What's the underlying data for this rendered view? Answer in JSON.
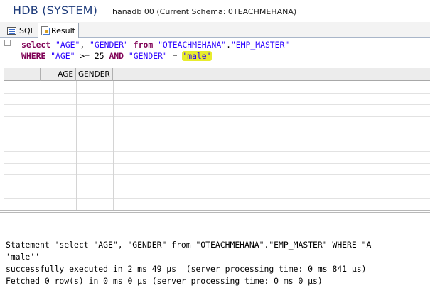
{
  "window": {
    "title": "HDB (SYSTEM)",
    "subtitle": "hanadb 00 (Current Schema: 0TEACHMEHANA)"
  },
  "tabs": [
    {
      "label": "SQL",
      "icon": "sql-editor-icon",
      "active": false
    },
    {
      "label": "Result",
      "icon": "result-icon",
      "active": true
    }
  ],
  "editor": {
    "line1": {
      "kw_select": "select",
      "col1": "\"AGE\"",
      "comma": ", ",
      "col2": "\"GENDER\"",
      "kw_from": "from",
      "schema": "\"OTEACHMEHANA\"",
      "dot": ".",
      "table": "\"EMP_MASTER\""
    },
    "line2": {
      "kw_where": "WHERE",
      "col1": "\"AGE\"",
      "op1": " >= 25 ",
      "kw_and": "AND",
      "col2": "\"GENDER\"",
      "op2": " = ",
      "literal": "'male'"
    },
    "highlight_color": "#e8ec2e"
  },
  "result_grid": {
    "columns": [
      "",
      "AGE",
      "GENDER"
    ],
    "rows": []
  },
  "console": {
    "lines": [
      "Statement 'select \"AGE\", \"GENDER\" from \"OTEACHMEHANA\".\"EMP_MASTER\" WHERE \"A",
      "'male''",
      "successfully executed in 2 ms 49 µs  (server processing time: 0 ms 841 µs)",
      "Fetched 0 row(s) in 0 ms 0 µs (server processing time: 0 ms 0 µs)"
    ]
  },
  "colors": {
    "keyword": "#7f0055",
    "string": "#2a00ff",
    "title": "#1c3a7a"
  }
}
